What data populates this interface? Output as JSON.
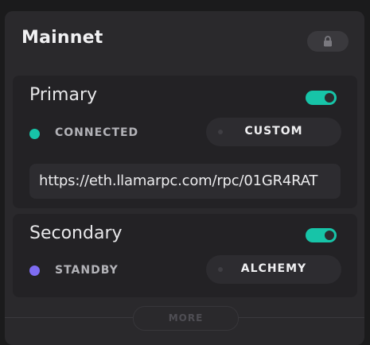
{
  "network": {
    "title": "Mainnet",
    "lock_icon": "lock-icon"
  },
  "primary": {
    "name": "Primary",
    "enabled": true,
    "status": "CONNECTED",
    "status_color": "#17c4a8",
    "provider": "CUSTOM",
    "rpc_url": "https://eth.llamarpc.com/rpc/01GR4RAT"
  },
  "secondary": {
    "name": "Secondary",
    "enabled": true,
    "status": "STANDBY",
    "status_color": "#7e6cf2",
    "provider": "ALCHEMY"
  },
  "footer": {
    "more_label": "MORE"
  },
  "colors": {
    "accent": "#17c4a8",
    "standby": "#7e6cf2"
  }
}
